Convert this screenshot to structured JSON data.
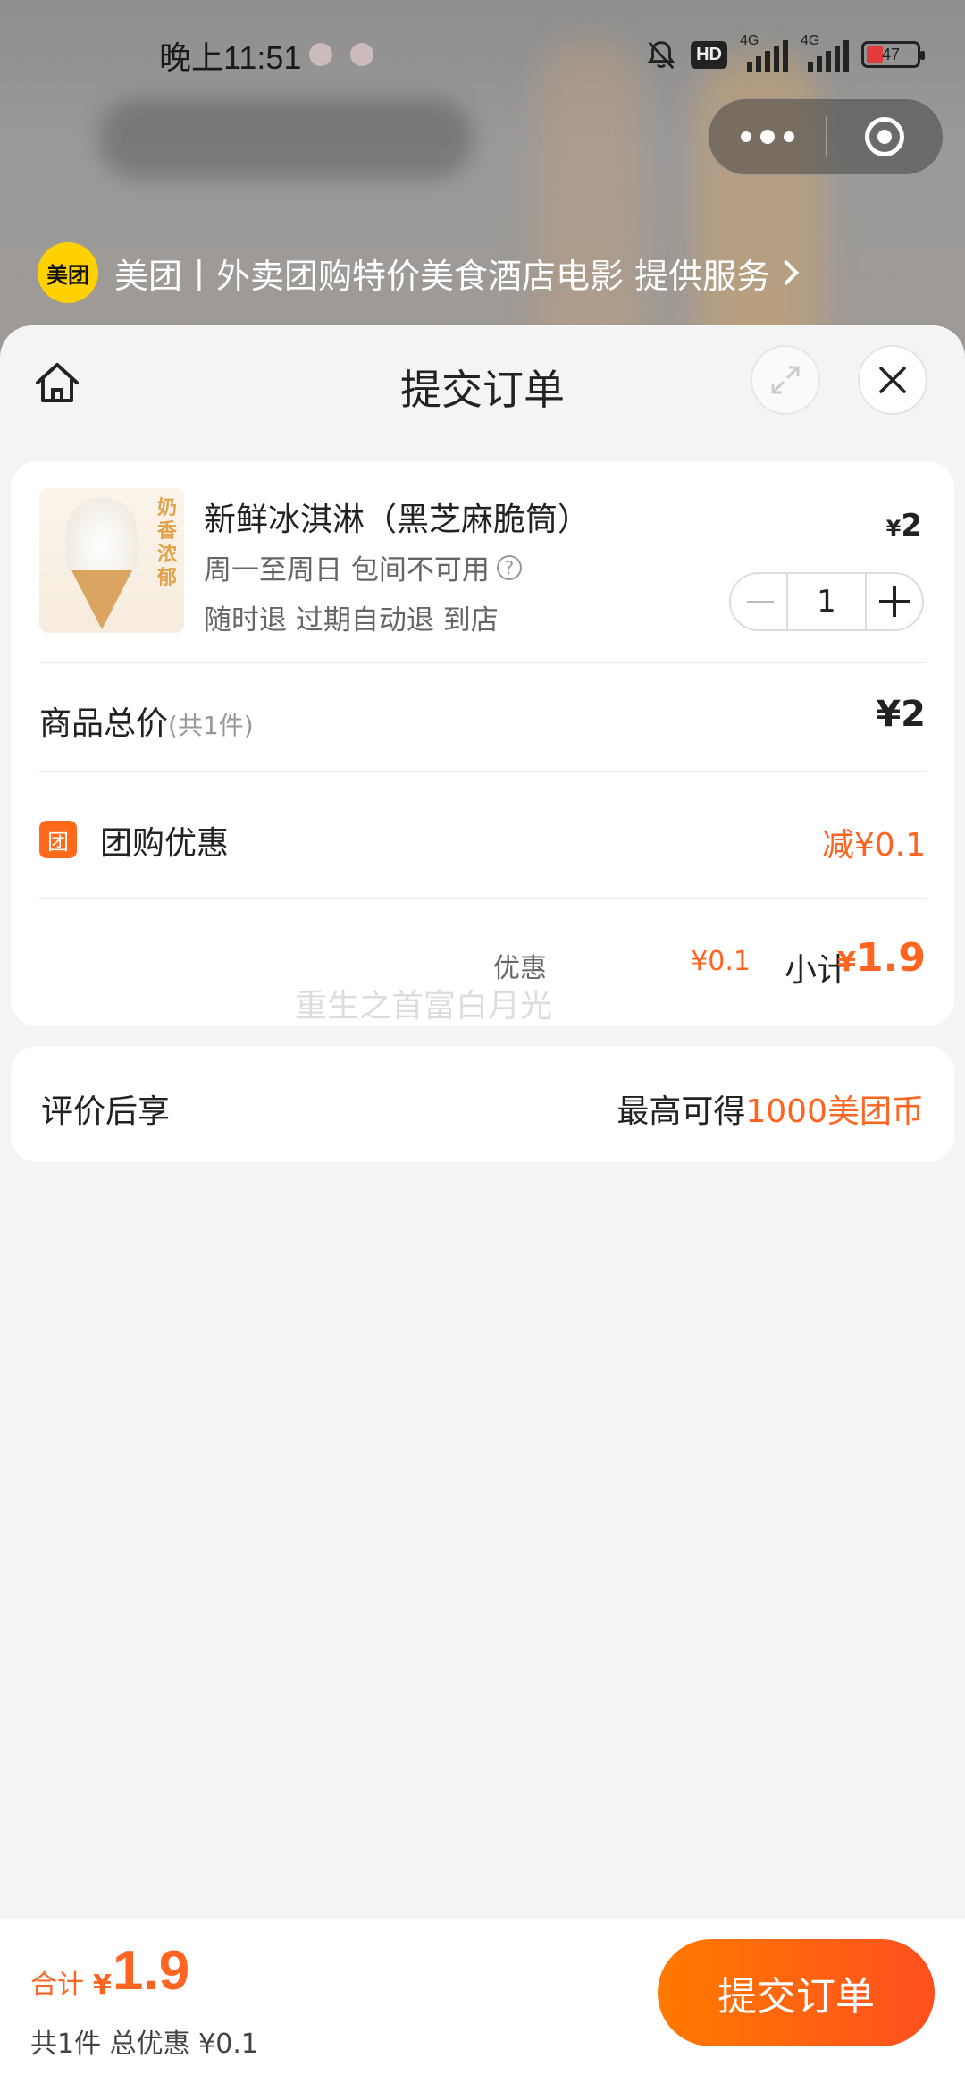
{
  "status_bar": {
    "time": "晚上11:51",
    "hd_label": "HD",
    "signal1_label": "4G",
    "signal2_label": "4G",
    "battery": "47"
  },
  "provider": {
    "logo_text": "美团",
    "text": "美团丨外卖团购特价美食酒店电影 提供服务"
  },
  "sheet": {
    "title": "提交订单"
  },
  "product": {
    "name": "新鲜冰淇淋（黑芝麻脆筒）",
    "image_slogan": "奶香浓郁",
    "price_symbol": "¥",
    "price": "2",
    "availability": "周一至周日 包间不可用",
    "help_icon_text": "?",
    "policy": "随时退 过期自动退 到店",
    "quantity": "1"
  },
  "summary": {
    "total_label": "商品总价",
    "total_count": "(共1件)",
    "total_value": "¥2",
    "discount_badge": "团",
    "discount_label": "团购优惠",
    "discount_value": "减¥0.1",
    "subtotal_discount_label": "优惠",
    "subtotal_discount_value": "¥0.1",
    "subtotal_label": "小计",
    "subtotal_yen": "¥",
    "subtotal_value": "1.9"
  },
  "watermark": "重生之首富白月光",
  "review": {
    "label": "评价后享",
    "prefix": "最高可得",
    "reward": "1000美团币"
  },
  "bottom": {
    "total_label": "合计",
    "total_yen": "¥",
    "total_value": "1.9",
    "total_sub": "共1件 总优惠 ¥0.1",
    "submit_label": "提交订单"
  },
  "colors": {
    "accent": "#ff6421",
    "brand_yellow": "#ffd100"
  }
}
